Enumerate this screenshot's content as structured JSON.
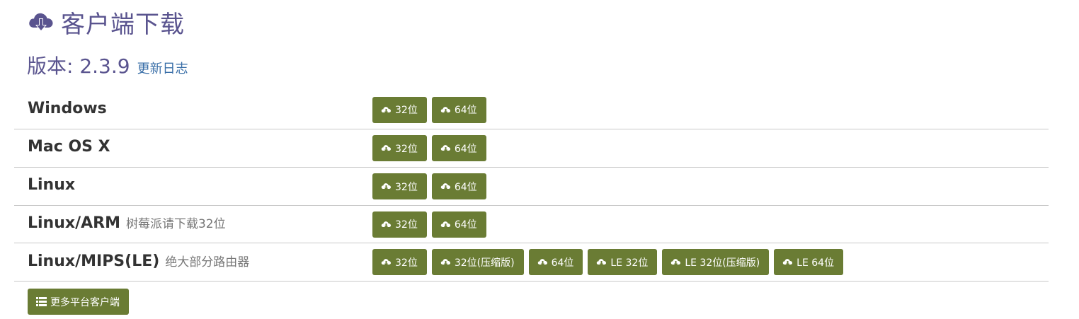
{
  "header": {
    "title": "客户端下载",
    "icon": "cloud-download-icon"
  },
  "version": {
    "label": "版本: 2.3.9",
    "changelog_link": "更新日志"
  },
  "platforms": [
    {
      "name": "Windows",
      "note": "",
      "buttons": [
        "32位",
        "64位"
      ]
    },
    {
      "name": "Mac OS X",
      "note": "",
      "buttons": [
        "32位",
        "64位"
      ]
    },
    {
      "name": "Linux",
      "note": "",
      "buttons": [
        "32位",
        "64位"
      ]
    },
    {
      "name": "Linux/ARM",
      "note": "树莓派请下载32位",
      "buttons": [
        "32位",
        "64位"
      ]
    },
    {
      "name": "Linux/MIPS(LE)",
      "note": "绝大部分路由器",
      "buttons": [
        "32位",
        "32位(压缩版)",
        "64位",
        "LE 32位",
        "LE 32位(压缩版)",
        "LE 64位"
      ]
    }
  ],
  "more_button": {
    "label": "更多平台客户端",
    "icon": "list-icon"
  },
  "colors": {
    "title": "#5a548f",
    "link": "#3a6fa8",
    "button_bg": "#6a7c34",
    "button_text": "#ffffff",
    "divider": "#c8c8c8"
  }
}
